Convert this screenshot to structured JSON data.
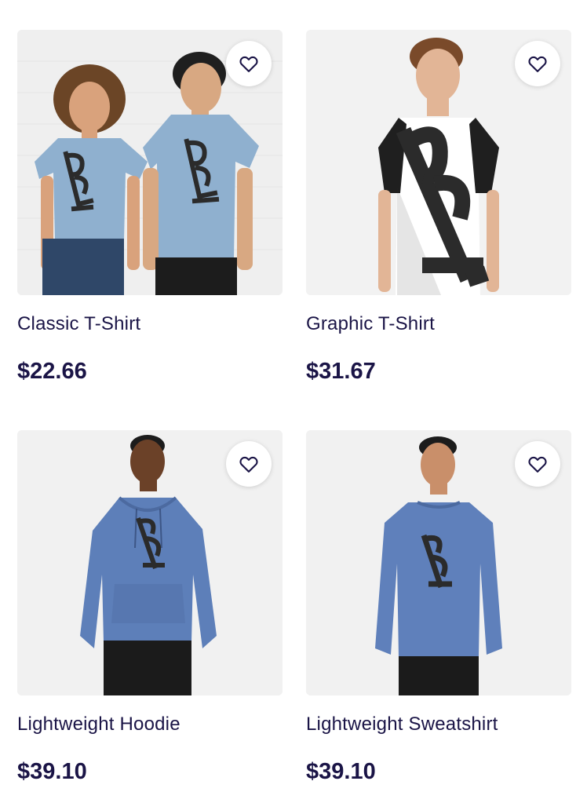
{
  "products": [
    {
      "title": "Classic T-Shirt",
      "price": "$22.66",
      "garment_color": "#8fb0cf",
      "favorite_icon": "heart-outline-icon"
    },
    {
      "title": "Graphic T-Shirt",
      "price": "$31.67",
      "garment_color": "#ffffff",
      "favorite_icon": "heart-outline-icon"
    },
    {
      "title": "Lightweight Hoodie",
      "price": "$39.10",
      "garment_color": "#5d7fb9",
      "favorite_icon": "heart-outline-icon"
    },
    {
      "title": "Lightweight Sweatshirt",
      "price": "$39.10",
      "garment_color": "#5f80bb",
      "favorite_icon": "heart-outline-icon"
    }
  ],
  "colors": {
    "text": "#1a1446",
    "design": "#2b2b2b"
  }
}
